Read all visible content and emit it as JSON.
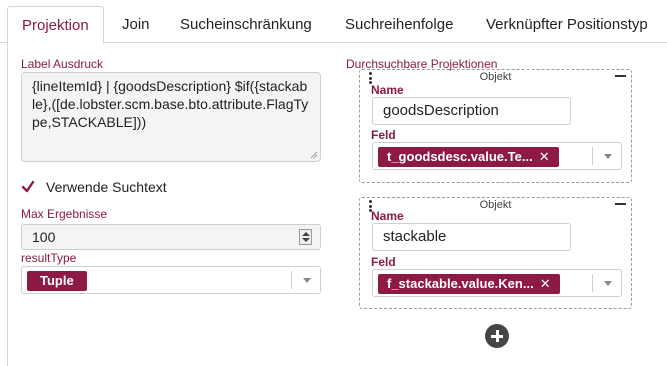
{
  "tabs": [
    {
      "label": "Projektion",
      "active": true
    },
    {
      "label": "Join",
      "active": false
    },
    {
      "label": "Sucheinschränkung",
      "active": false
    },
    {
      "label": "Suchreihenfolge",
      "active": false
    },
    {
      "label": "Verknüpfter Positionstyp",
      "active": false
    }
  ],
  "left": {
    "label_ausdruck": "Label Ausdruck",
    "label_ausdruck_value": "{lineItemId} | {goodsDescription} $if({stackable},([de.lobster.scm.base.bto.attribute.FlagType,STACKABLE]))",
    "use_search_text_label": "Verwende Suchtext",
    "use_search_text_checked": true,
    "max_results_label": "Max Ergebnisse",
    "max_results_value": "100",
    "result_type_label": "resultType",
    "result_type_value": "Tuple"
  },
  "right": {
    "title": "Durchsuchbare Projektionen",
    "objects": [
      {
        "header": "Objekt",
        "name_label": "Name",
        "name_value": "goodsDescription",
        "field_label": "Feld",
        "field_value": "t_goodsdesc.value.Te..."
      },
      {
        "header": "Objekt",
        "name_label": "Name",
        "name_value": "stackable",
        "field_label": "Feld",
        "field_value": "f_stackable.value.Ken..."
      }
    ]
  },
  "colors": {
    "accent": "#8c1a45",
    "border": "#cfcfcf",
    "text": "#222222"
  },
  "icons": {
    "remove": "close-icon",
    "drag": "drag-handle-icon",
    "collapse": "minus-icon",
    "add": "plus-circle-icon",
    "dropdown": "chevron-down-icon",
    "check": "check-icon"
  }
}
